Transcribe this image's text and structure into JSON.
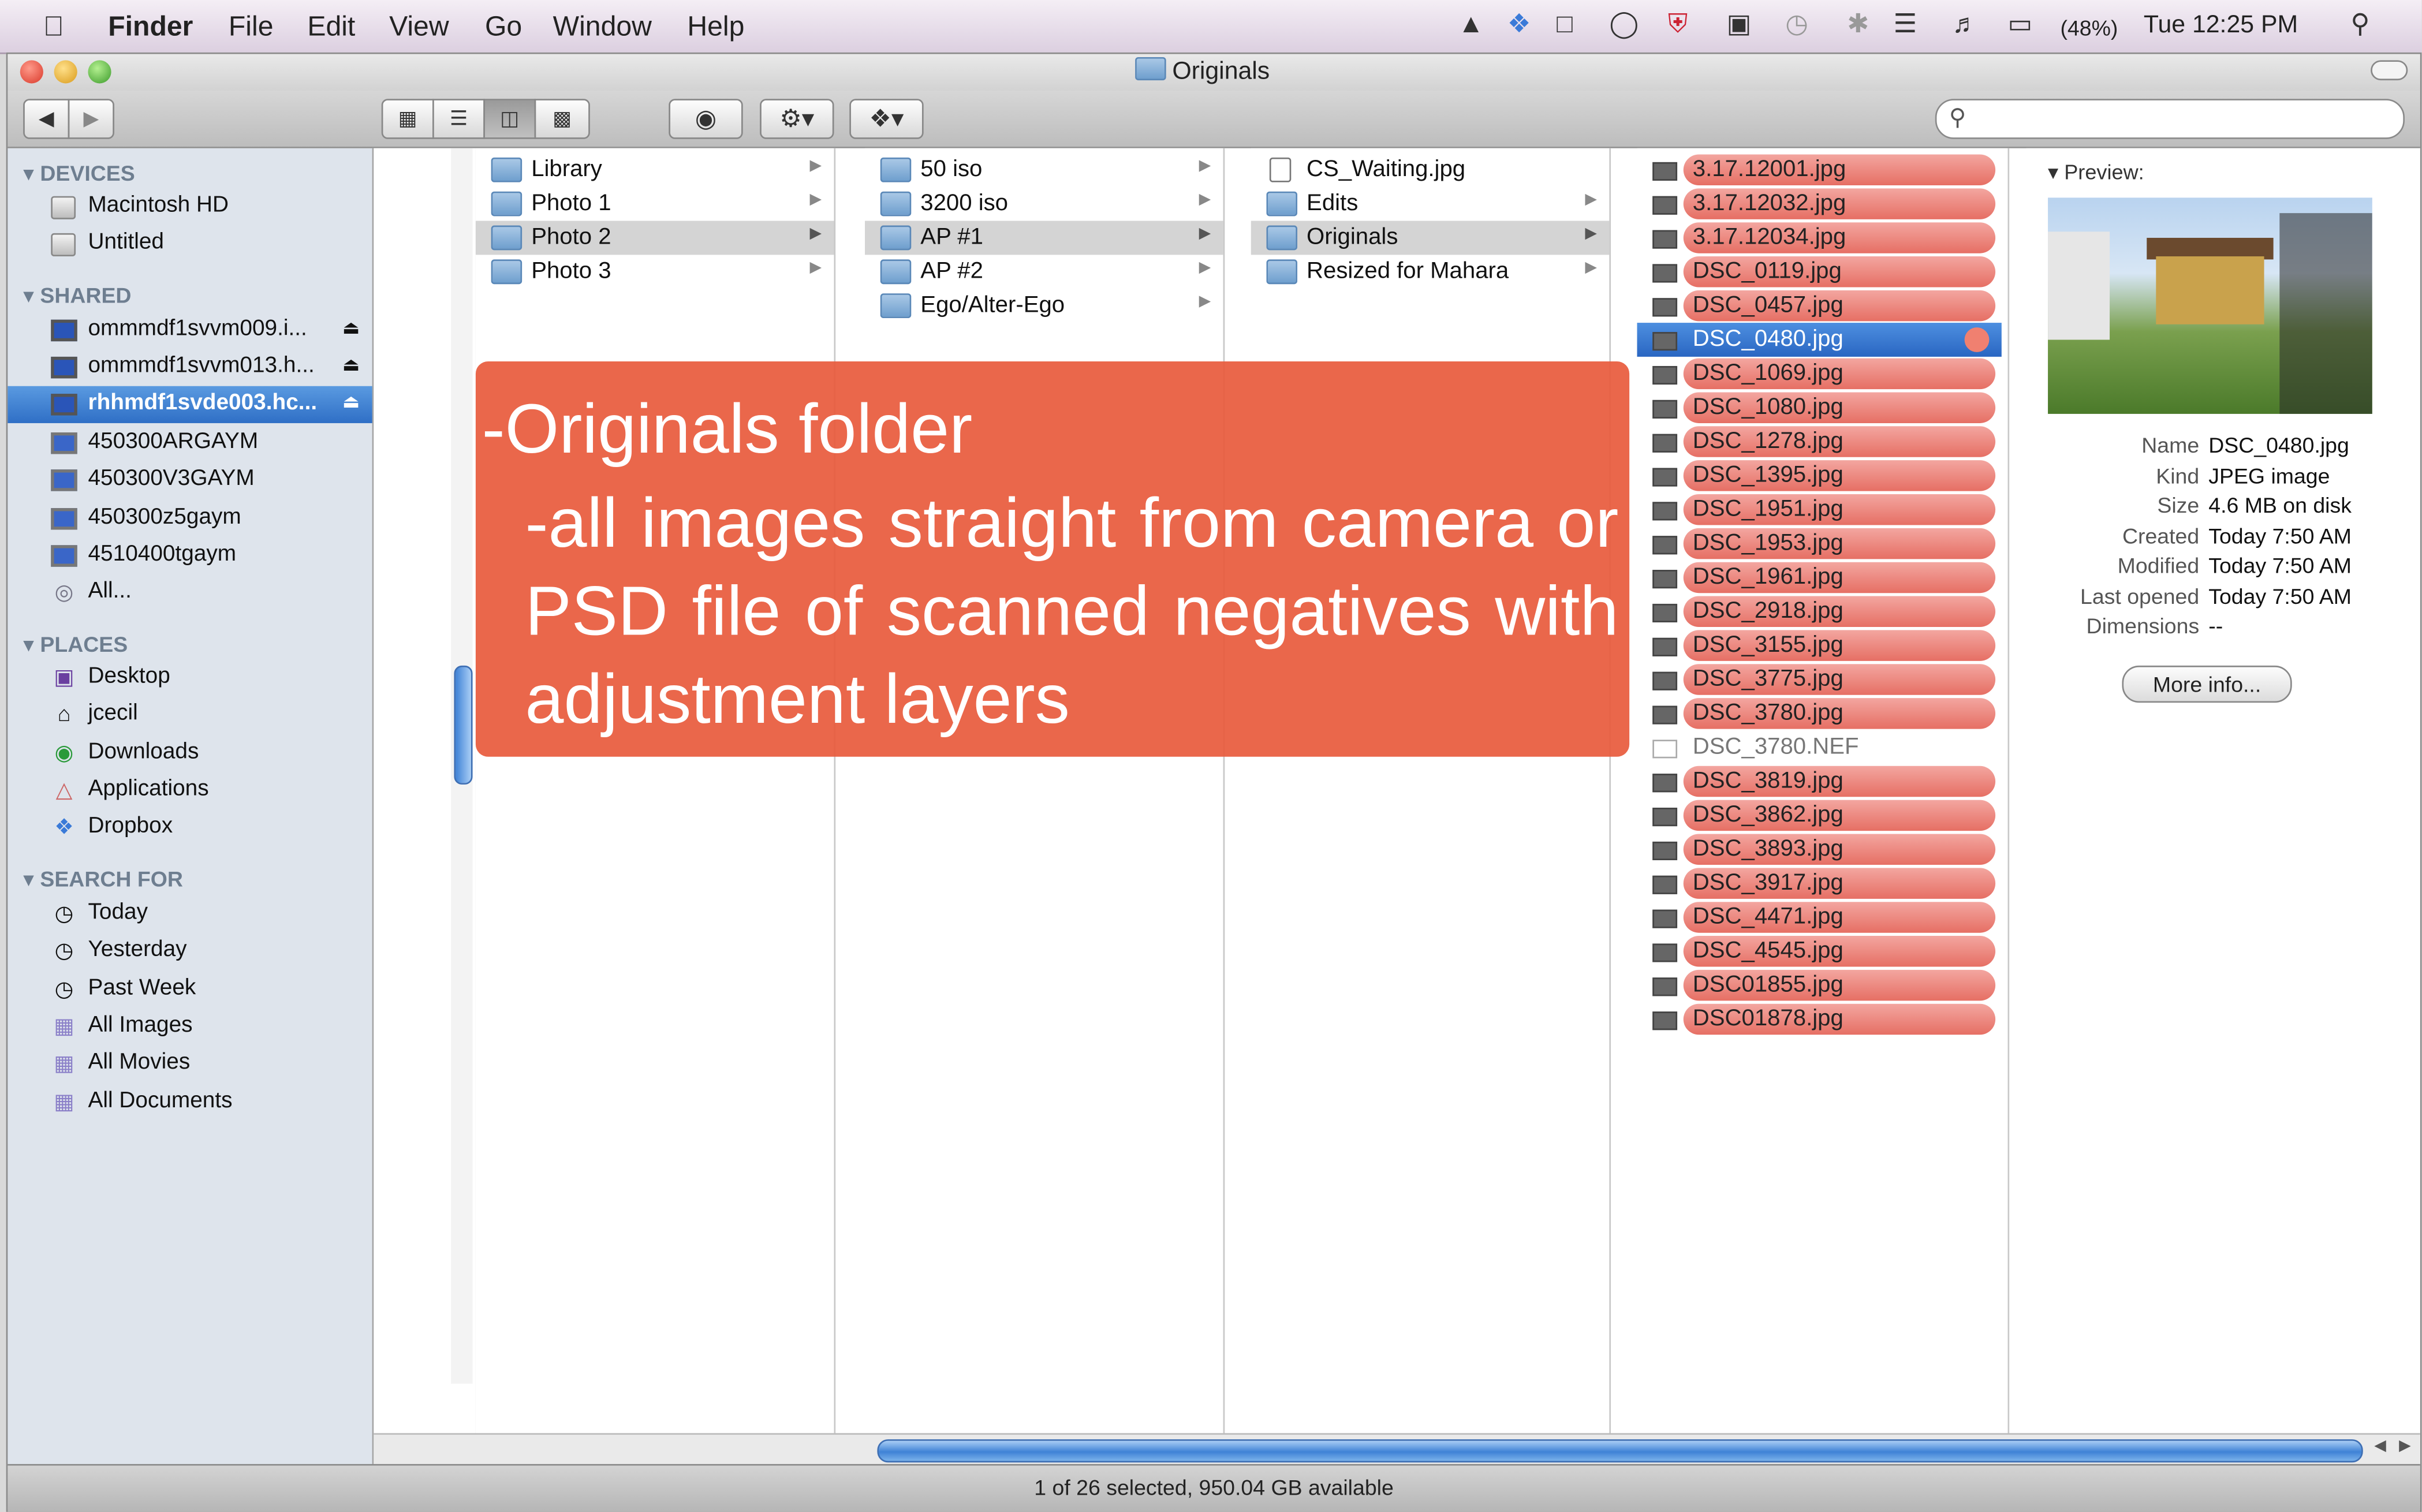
{
  "menubar": {
    "apple": "",
    "app": "Finder",
    "menus": [
      "File",
      "Edit",
      "View",
      "Go",
      "Window",
      "Help"
    ],
    "battery": "(48%)",
    "clock": "Tue 12:25 PM"
  },
  "window": {
    "title": "Originals",
    "status": "1 of 26 selected, 950.04 GB available"
  },
  "toolbar": {
    "back": "◀",
    "forward": "▶",
    "views": [
      "icon-view",
      "list-view",
      "column-view",
      "coverflow-view"
    ],
    "selected_view": "column-view",
    "search_placeholder": ""
  },
  "sidebar": {
    "devices_header": "DEVICES",
    "devices": [
      "Macintosh HD",
      "Untitled"
    ],
    "shared_header": "SHARED",
    "shared": [
      "ommmdf1svvm009.i...",
      "ommmdf1svvm013.h...",
      "rhhmdf1svde003.hc...",
      "450300ARGAYM",
      "450300V3GAYM",
      "450300z5gaym",
      "4510400tgaym",
      "All..."
    ],
    "places_header": "PLACES",
    "places": [
      "Desktop",
      "jcecil",
      "Downloads",
      "Applications",
      "Dropbox"
    ],
    "search_header": "SEARCH FOR",
    "search": [
      "Today",
      "Yesterday",
      "Past Week",
      "All Images",
      "All Movies",
      "All Documents"
    ]
  },
  "columns": {
    "col1": [
      "Library",
      "Photo 1",
      "Photo 2",
      "Photo 3"
    ],
    "col2": [
      "50 iso",
      "3200 iso",
      "AP #1",
      "AP #2",
      "Ego/Alter-Ego"
    ],
    "col3": [
      "CS_Waiting.jpg",
      "Edits",
      "Originals",
      "Resized for Mahara"
    ],
    "files": [
      "3.17.12001.jpg",
      "3.17.12032.jpg",
      "3.17.12034.jpg",
      "DSC_0119.jpg",
      "DSC_0457.jpg",
      "DSC_0480.jpg",
      "DSC_1069.jpg",
      "DSC_1080.jpg",
      "DSC_1278.jpg",
      "DSC_1395.jpg",
      "DSC_1951.jpg",
      "DSC_1953.jpg",
      "DSC_1961.jpg",
      "DSC_2918.jpg",
      "DSC_3155.jpg",
      "DSC_3775.jpg",
      "DSC_3780.jpg",
      "DSC_3780.NEF",
      "DSC_3819.jpg",
      "DSC_3862.jpg",
      "DSC_3893.jpg",
      "DSC_3917.jpg",
      "DSC_4471.jpg",
      "DSC_4545.jpg",
      "DSC01855.jpg",
      "DSC01878.jpg"
    ],
    "selected_file": "DSC_0480.jpg"
  },
  "preview": {
    "header": "Preview:",
    "name_key": "Name",
    "name_val": "DSC_0480.jpg",
    "kind_key": "Kind",
    "kind_val": "JPEG image",
    "size_key": "Size",
    "size_val": "4.6 MB on disk",
    "created_key": "Created",
    "created_val": "Today 7:50 AM",
    "modified_key": "Modified",
    "modified_val": "Today 7:50 AM",
    "opened_key": "Last opened",
    "opened_val": "Today 7:50 AM",
    "dims_key": "Dimensions",
    "dims_val": "--",
    "more_info": "More info..."
  },
  "overlay": {
    "line1": "-Originals folder",
    "line2": "-all images straight from camera or PSD file of scanned negatives with adjustment layers"
  },
  "colors": {
    "label_red": "#e66f64",
    "selection_blue": "#2f6fc6",
    "overlay": "#e85a3c"
  }
}
